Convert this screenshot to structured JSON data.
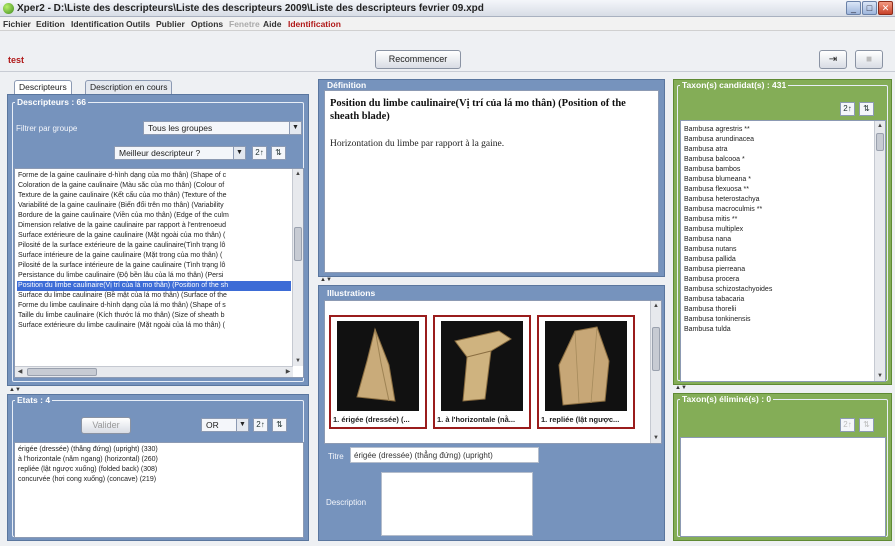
{
  "window": {
    "title": "Xper2 - D:\\Liste des descripteurs\\Liste des descripteurs 2009\\Liste des descripteurs fevrier 09.xpd",
    "controls": {
      "minimize": "_",
      "maximize": "□",
      "close": "✕"
    }
  },
  "menu": {
    "items": [
      "Fichier",
      "Edition",
      "Identification",
      "Outils",
      "Publier",
      "Options",
      "Fenetre",
      "Aide",
      "Identification"
    ]
  },
  "toolbar": {
    "user_label": "test",
    "restart_label": "Recommencer",
    "icons": [
      "export-icon",
      "stop-icon"
    ]
  },
  "left": {
    "tabs": [
      "Descripteurs",
      "Description en cours"
    ],
    "descriptors_title": "Descripteurs : 66",
    "filter_label": "Filtrer par groupe",
    "group_select": "Tous les groupes",
    "best_select": "Meilleur descripteur ?",
    "descriptors": [
      "Forme de la gaine caulinaire d-hình dạng của mo thân) (Shape of c",
      "Coloration de la gaine caulinaire (Màu sắc của mo thân) (Colour of",
      "Texture de la gaine caulinaire (Kết cấu của mo thân) (Texture of the",
      "Variabilité de la gaine caulinaire (Biến đổi trên mo thân) (Variability",
      "Bordure de la gaine caulinaire (Viền của mo thân) (Edge of the culm",
      "Dimension relative de la gaine caulinaire par rapport à l'entrenoeud",
      "Surface extérieure de la gaine caulinaire (Mặt ngoài của mo thân) (",
      "Pilosité de la surface extérieure de la gaine caulinaire(Tình trạng lô",
      "Surface intérieure de la gaine caulinaire (Mặt trong của mo thân) (",
      "Pilosité de la surface intérieure de la gaine caulinaire (Tình trạng lô",
      "Persistance du limbe caulinaire (Độ bền lâu của lá mo thân) (Persi",
      "Position du limbe caulinaire(Vị trí của lá mo thân) (Position of the sh",
      "Surface du limbe caulinaire (Bề mặt của lá mo thân) (Surface of the",
      "Forme du limbe caulinaire d-hình dạng của lá mo thân) (Shape of s",
      "Taille du limbe caulinaire (Kích thước lá mo thân) (Size of sheath b",
      "Surface extérieure du limbe caulinaire (Mặt ngoài của lá mo thân) ("
    ],
    "selected_index": 11,
    "states_title": "Etats : 4",
    "validate_label": "Valider",
    "operator_select": "OR",
    "states": [
      "érigée (dressée) (thẳng đứng) (upright) (330)",
      "à l'horizontale (nằm ngang) (horizontal) (260)",
      "repliée (lật ngược xuống) (folded back) (308)",
      "concurvée (hơi cong xuống) (concave) (219)"
    ]
  },
  "middle": {
    "definition_title": "Définition",
    "definition_heading": "Position du limbe caulinaire(Vị trí của lá mo thân) (Position of the sheath blade)",
    "definition_text": "Horizontation du limbe par rapport à la gaine.",
    "illustrations_title": "Illustrations",
    "thumbnails": [
      "1. érigée (dressée) (...",
      "1. à l'horizontale (nằ...",
      "1. repliée (lật ngược..."
    ],
    "title_label": "Titre",
    "title_value": "érigée (dressée) (thẳng đứng) (upright)",
    "description_label": "Description",
    "description_value": ""
  },
  "right": {
    "candidates_title": "Taxon(s) candidat(s) : 431",
    "candidates": [
      "Bambusa agrestris **",
      "Bambusa arundinacea",
      "Bambusa atra",
      "Bambusa balcooa *",
      "Bambusa bambos",
      "Bambusa blumeana *",
      "Bambusa flexuosa **",
      "Bambusa heterostachya",
      "Bambusa macroculmis **",
      "Bambusa mitis **",
      "Bambusa multiplex",
      "Bambusa nana",
      "Bambusa nutans",
      "Bambusa pallida",
      "Bambusa pierreana",
      "Bambusa procera",
      "Bambusa schizostachyoides",
      "Bambusa tabacaria",
      "Bambusa thorelii",
      "Bambusa tonkinensis",
      "Bambusa tulda"
    ],
    "eliminated_title": "Taxon(s) éliminé(s) : 0"
  },
  "colors": {
    "blue_panel": "#7693bd",
    "green_panel": "#84ad57",
    "selection": "#3d6cd6",
    "accent_red": "#b01818"
  }
}
